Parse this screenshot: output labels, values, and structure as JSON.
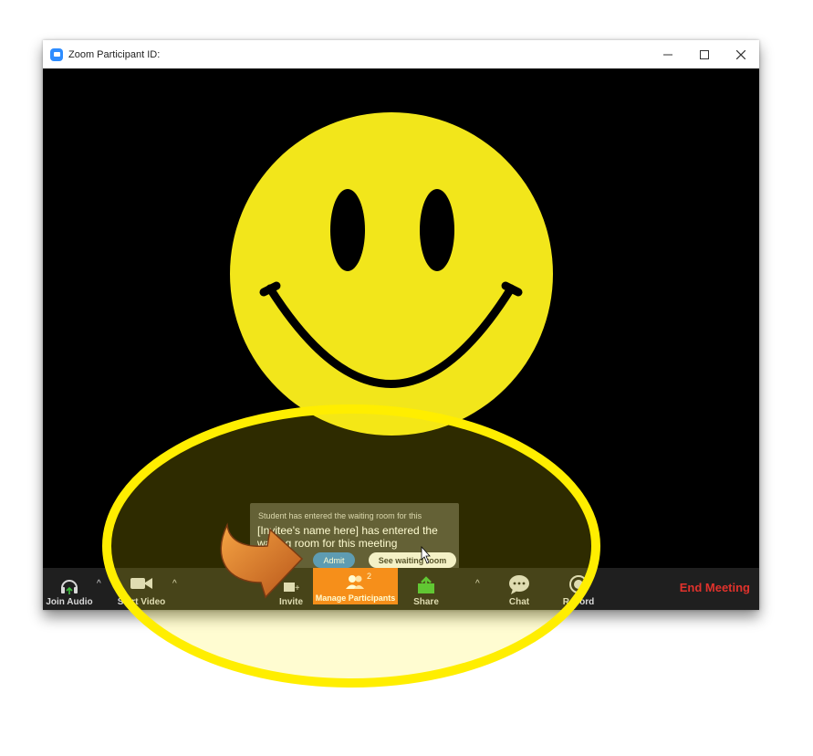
{
  "window": {
    "title": "Zoom Participant ID:",
    "controls": [
      "minimize",
      "maximize",
      "close"
    ]
  },
  "notification": {
    "header": "Student has entered the waiting room for this",
    "message": "[Invitee's name here] has entered the waiting room for this meeting",
    "admit_label": "Admit",
    "see_waiting_room_label": "See waiting room"
  },
  "toolbar": {
    "join_audio": "Join Audio",
    "start_video": "Start Video",
    "invite": "Invite",
    "manage_participants": "Manage Participants",
    "participant_count": "2",
    "share": "Share",
    "chat": "Chat",
    "record": "Record",
    "end_meeting": "End Meeting"
  },
  "colors": {
    "highlight_ellipse": "#ffee00",
    "smiley_face": "#f2e61b",
    "manage_button": "#f47a20",
    "end_meeting": "#e0322c",
    "admit_button": "#3b8ad9",
    "arrow": "#d8731e"
  }
}
